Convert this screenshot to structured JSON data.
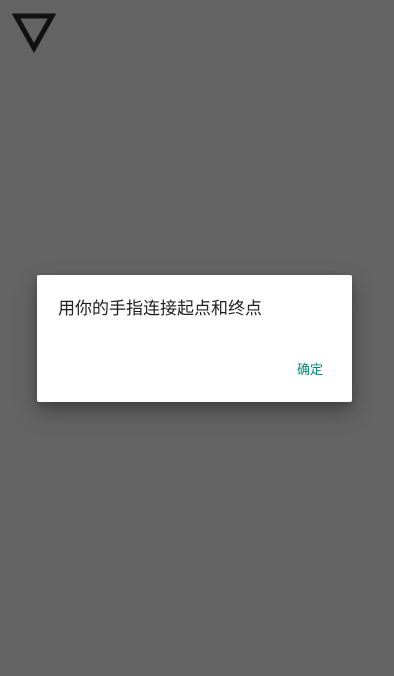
{
  "app": {
    "logo_icon": "down-triangle-logo-icon",
    "background_color": "#646464"
  },
  "dialog": {
    "message": "用你的手指连接起点和终点",
    "confirm_label": "确定",
    "confirm_color": "#00897B"
  }
}
